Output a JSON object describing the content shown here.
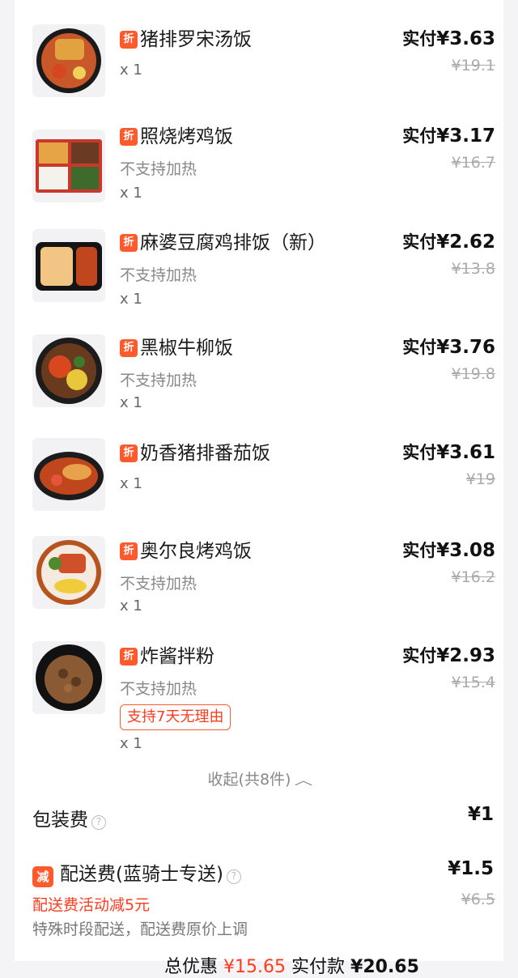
{
  "discount_badge": "折",
  "items": [
    {
      "name": "猪排罗宋汤饭",
      "note": "",
      "tag": "",
      "qty": "x 1",
      "paid_label": "实付",
      "paid": "¥3.63",
      "original": "¥19.1"
    },
    {
      "name": "照烧烤鸡饭",
      "note": "不支持加热",
      "tag": "",
      "qty": "x 1",
      "paid_label": "实付",
      "paid": "¥3.17",
      "original": "¥16.7"
    },
    {
      "name": "麻婆豆腐鸡排饭（新）",
      "note": "不支持加热",
      "tag": "",
      "qty": "x 1",
      "paid_label": "实付",
      "paid": "¥2.62",
      "original": "¥13.8"
    },
    {
      "name": "黑椒牛柳饭",
      "note": "不支持加热",
      "tag": "",
      "qty": "x 1",
      "paid_label": "实付",
      "paid": "¥3.76",
      "original": "¥19.8"
    },
    {
      "name": "奶香猪排番茄饭",
      "note": "",
      "tag": "",
      "qty": "x 1",
      "paid_label": "实付",
      "paid": "¥3.61",
      "original": "¥19"
    },
    {
      "name": "奥尔良烤鸡饭",
      "note": "不支持加热",
      "tag": "",
      "qty": "x 1",
      "paid_label": "实付",
      "paid": "¥3.08",
      "original": "¥16.2"
    },
    {
      "name": "炸酱拌粉",
      "note": "不支持加热",
      "tag": "支持7天无理由",
      "qty": "x 1",
      "paid_label": "实付",
      "paid": "¥2.93",
      "original": "¥15.4"
    }
  ],
  "collapse_label": "收起(共8件)",
  "packaging": {
    "label": "包装费",
    "value": "¥1"
  },
  "delivery": {
    "icon": "减",
    "label": "配送费(蓝骑士专送)",
    "value": "¥1.5",
    "original": "¥6.5",
    "promo": "配送费活动减5元",
    "notice": "特殊时段配送，配送费原价上调"
  },
  "footer_partial": {
    "total_label": "总优惠",
    "total_value": "¥15.65",
    "paid_label": "实付款",
    "paid_value": "¥20.65"
  }
}
